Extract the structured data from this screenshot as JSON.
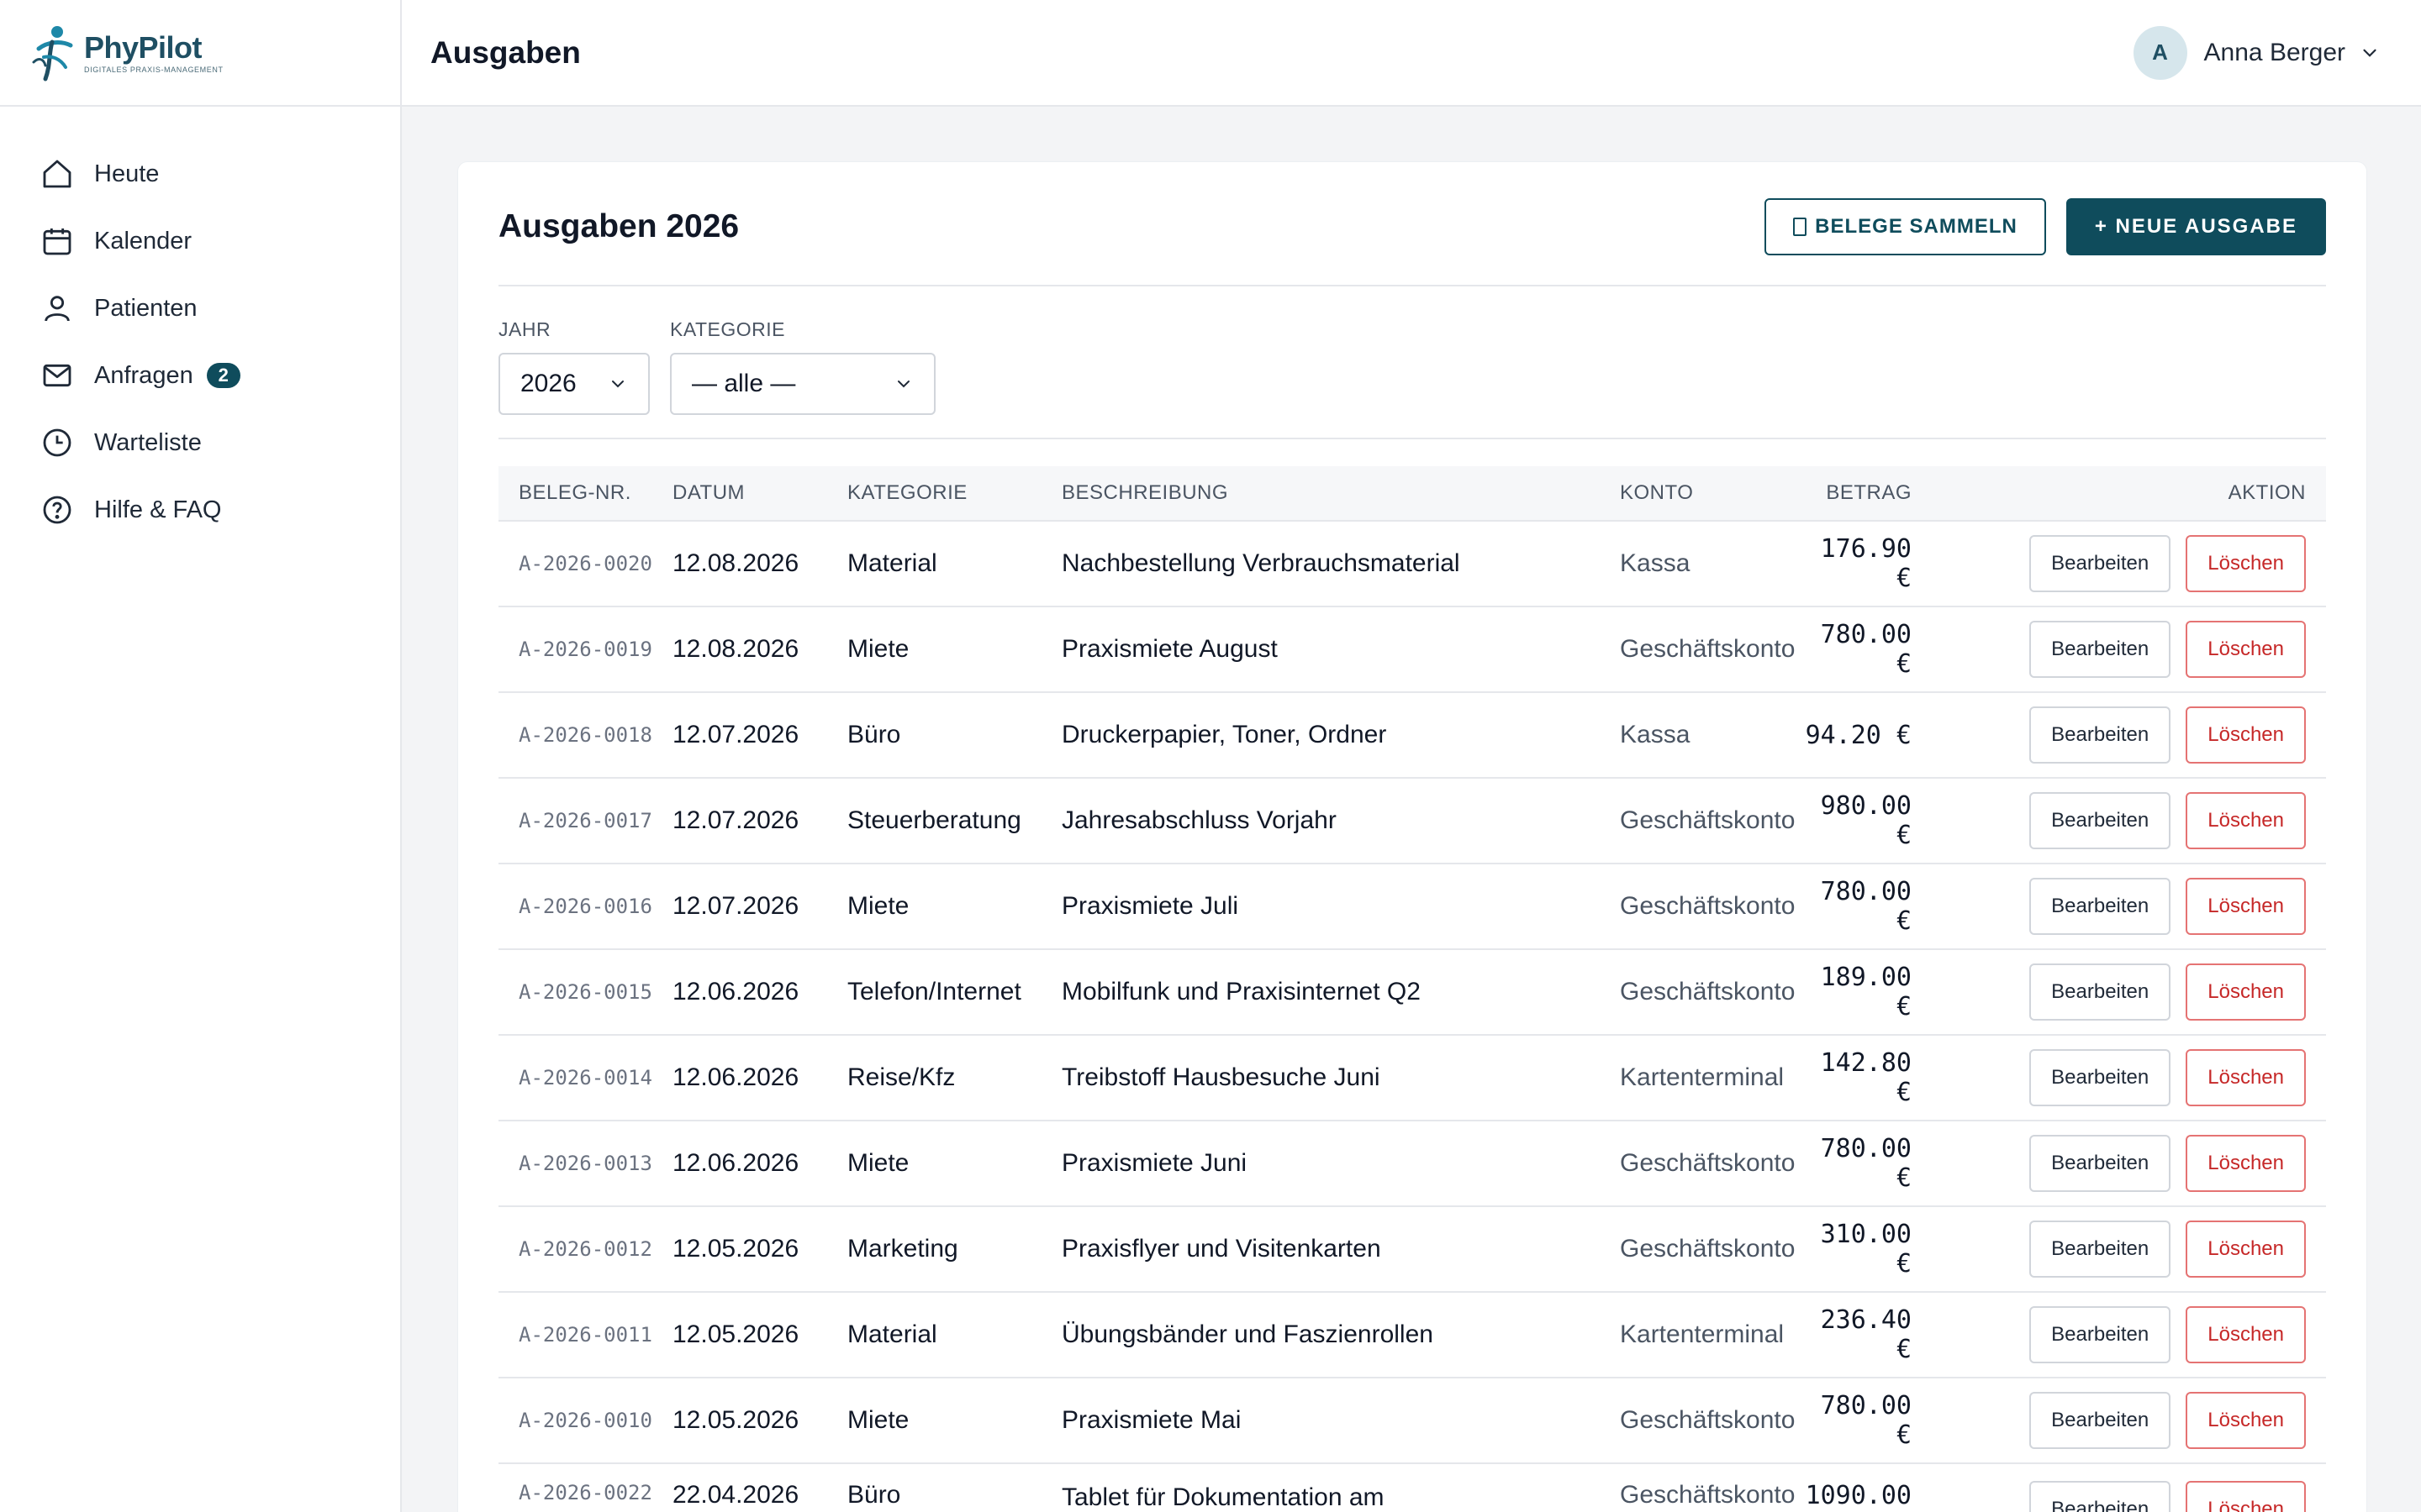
{
  "brand": {
    "name": "PhyPilot",
    "tagline": "DIGITALES PRAXIS-MANAGEMENT",
    "colors": {
      "primary": "#0f4c5c",
      "accent": "#1e88a8"
    }
  },
  "sidebar": {
    "items": [
      {
        "label": "Heute",
        "icon": "home-icon"
      },
      {
        "label": "Kalender",
        "icon": "calendar-icon"
      },
      {
        "label": "Patienten",
        "icon": "user-icon"
      },
      {
        "label": "Anfragen",
        "icon": "mail-icon",
        "badge": "2"
      },
      {
        "label": "Warteliste",
        "icon": "clock-icon"
      },
      {
        "label": "Hilfe & FAQ",
        "icon": "help-icon"
      }
    ]
  },
  "header": {
    "title": "Ausgaben",
    "user": {
      "initial": "A",
      "name": "Anna Berger"
    }
  },
  "card": {
    "title": "Ausgaben 2026",
    "collect_button": "BELEGE SAMMELN",
    "new_button": "+ NEUE AUSGABE"
  },
  "filters": {
    "year_label": "JAHR",
    "year_value": "2026",
    "category_label": "KATEGORIE",
    "category_value": "— alle —"
  },
  "table": {
    "headers": {
      "id": "BELEG-NR.",
      "date": "DATUM",
      "category": "KATEGORIE",
      "description": "BESCHREIBUNG",
      "account": "KONTO",
      "amount": "BETRAG",
      "action": "AKTION"
    },
    "edit_label": "Bearbeiten",
    "delete_label": "Löschen",
    "rows": [
      {
        "id": "A-2026-0020",
        "date": "12.08.2026",
        "category": "Material",
        "description": "Nachbestellung Verbrauchsmaterial",
        "account": "Kassa",
        "amount": "176.90 €"
      },
      {
        "id": "A-2026-0019",
        "date": "12.08.2026",
        "category": "Miete",
        "description": "Praxismiete August",
        "account": "Geschäftskonto",
        "amount": "780.00 €"
      },
      {
        "id": "A-2026-0018",
        "date": "12.07.2026",
        "category": "Büro",
        "description": "Druckerpapier, Toner, Ordner",
        "account": "Kassa",
        "amount": "94.20 €"
      },
      {
        "id": "A-2026-0017",
        "date": "12.07.2026",
        "category": "Steuerberatung",
        "description": "Jahresabschluss Vorjahr",
        "account": "Geschäftskonto",
        "amount": "980.00 €"
      },
      {
        "id": "A-2026-0016",
        "date": "12.07.2026",
        "category": "Miete",
        "description": "Praxismiete Juli",
        "account": "Geschäftskonto",
        "amount": "780.00 €"
      },
      {
        "id": "A-2026-0015",
        "date": "12.06.2026",
        "category": "Telefon/Internet",
        "description": "Mobilfunk und Praxisinternet Q2",
        "account": "Geschäftskonto",
        "amount": "189.00 €"
      },
      {
        "id": "A-2026-0014",
        "date": "12.06.2026",
        "category": "Reise/Kfz",
        "description": "Treibstoff Hausbesuche Juni",
        "account": "Kartenterminal",
        "amount": "142.80 €"
      },
      {
        "id": "A-2026-0013",
        "date": "12.06.2026",
        "category": "Miete",
        "description": "Praxismiete Juni",
        "account": "Geschäftskonto",
        "amount": "780.00 €"
      },
      {
        "id": "A-2026-0012",
        "date": "12.05.2026",
        "category": "Marketing",
        "description": "Praxisflyer und Visitenkarten",
        "account": "Geschäftskonto",
        "amount": "310.00 €"
      },
      {
        "id": "A-2026-0011",
        "date": "12.05.2026",
        "category": "Material",
        "description": "Übungsbänder und Faszienrollen",
        "account": "Kartenterminal",
        "amount": "236.40 €"
      },
      {
        "id": "A-2026-0010",
        "date": "12.05.2026",
        "category": "Miete",
        "description": "Praxismiete Mai",
        "account": "Geschäftskonto",
        "amount": "780.00 €"
      },
      {
        "id": "A-2026-0022",
        "date": "22.04.2026",
        "category": "Büro",
        "description": "Tablet für Dokumentation am",
        "account": "Geschäftskonto",
        "amount": "1090.00"
      }
    ]
  }
}
